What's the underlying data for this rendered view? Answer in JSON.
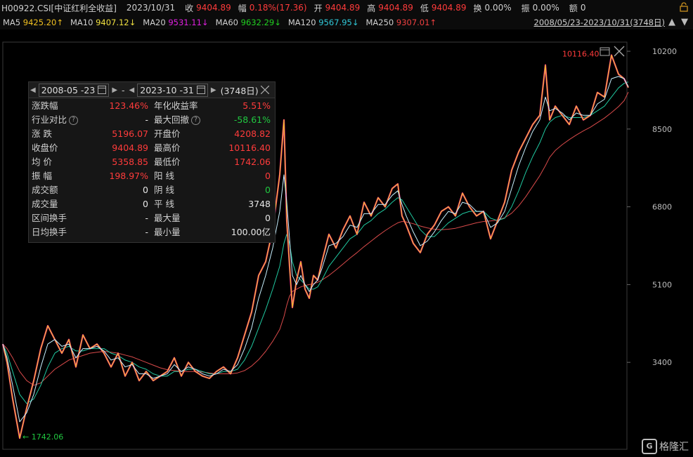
{
  "header": {
    "code": "H00922.CSI[中证红利全收益]",
    "date": "2023/10/31",
    "close_label": "收",
    "close": "9404.89",
    "change_label": "幅",
    "change": "0.18%(17.36)",
    "open_label": "开",
    "open": "9404.89",
    "high_label": "高",
    "high": "9404.89",
    "low_label": "低",
    "low": "9404.89",
    "turnover_label": "换",
    "turnover": "0.00%",
    "amplitude_label": "振",
    "amplitude": "0.00%",
    "amount_label": "额",
    "amount": "0"
  },
  "ma_bar": [
    {
      "label": "MA5",
      "value": "9425.20↑",
      "color": "#f0c020"
    },
    {
      "label": "MA10",
      "value": "9407.12↓",
      "color": "#f0e040"
    },
    {
      "label": "MA20",
      "value": "9531.11↓",
      "color": "#e020e0"
    },
    {
      "label": "MA60",
      "value": "9632.29↓",
      "color": "#20d020"
    },
    {
      "label": "MA120",
      "value": "9567.95↓",
      "color": "#30c8d8"
    },
    {
      "label": "MA250",
      "value": "9307.01↑",
      "color": "#f04040"
    }
  ],
  "range_text": "2008/05/23-2023/10/31(3748日)",
  "panel": {
    "start_date": "2008-05 -23",
    "dash": "-",
    "end_date": "2023-10 -31",
    "days": "(3748日)",
    "rows": [
      {
        "l1": "涨跌幅",
        "v1": "123.46%",
        "c1": "red",
        "l2": "年化收益率",
        "v2": "5.51%",
        "c2": "red"
      },
      {
        "l1": "行业对比",
        "q1": "?",
        "v1": "-",
        "c1": "white",
        "l2": "最大回撤",
        "q2": "?",
        "v2": "-58.61%",
        "c2": "green"
      },
      {
        "l1": "涨    跌",
        "v1": "5196.07",
        "c1": "red",
        "l2": "开盘价",
        "v2": "4208.82",
        "c2": "red"
      },
      {
        "l1": "收盘价",
        "v1": "9404.89",
        "c1": "red",
        "l2": "最高价",
        "v2": "10116.40",
        "c2": "red"
      },
      {
        "l1": "均    价",
        "v1": "5358.85",
        "c1": "red",
        "l2": "最低价",
        "v2": "1742.06",
        "c2": "red"
      },
      {
        "l1": "振    幅",
        "v1": "198.97%",
        "c1": "red",
        "l2": "阳    线",
        "v2": "0",
        "c2": "red"
      },
      {
        "l1": "成交额",
        "v1": "0",
        "c1": "white",
        "l2": "阴    线",
        "v2": "0",
        "c2": "green"
      },
      {
        "l1": "成交量",
        "v1": "0",
        "c1": "white",
        "l2": "平    线",
        "v2": "3748",
        "c2": "white"
      },
      {
        "l1": "区间换手",
        "v1": "-",
        "c1": "white",
        "l2": "最大量",
        "v2": "0",
        "c2": "white"
      },
      {
        "l1": "日均换手",
        "v1": "-",
        "c1": "white",
        "l2": "最小量",
        "v2": "100.00亿",
        "c2": "white"
      }
    ]
  },
  "watermark": "格隆汇",
  "colors": {
    "up": "#ff3b3b",
    "down": "#20c840",
    "price": "#e8d020"
  },
  "chart_data": {
    "type": "line",
    "y_ticks": [
      "10200",
      "8500",
      "6800",
      "5100",
      "3400"
    ],
    "ylim": [
      1500,
      10400
    ],
    "max_label": "10116.40",
    "min_label": "1742.06",
    "x": [
      0,
      6,
      14,
      24,
      34,
      44,
      54,
      64,
      74,
      84,
      94,
      104,
      114,
      124,
      134,
      144,
      154,
      164,
      174,
      184,
      194,
      204,
      214,
      224,
      234,
      244,
      254,
      264,
      274,
      284,
      294,
      304,
      314,
      324,
      334,
      344,
      354,
      364,
      374,
      384,
      394,
      400,
      404,
      408,
      412,
      418,
      424,
      430,
      436,
      442,
      448,
      454,
      464,
      474,
      484,
      494,
      504,
      514,
      524,
      534,
      544,
      554,
      562,
      568,
      574,
      584,
      594,
      604,
      614,
      624,
      634,
      644,
      654,
      664,
      674,
      684,
      694,
      704,
      714,
      724,
      734,
      744,
      754,
      764,
      772,
      778,
      786,
      796,
      806,
      816,
      826,
      836,
      846,
      856,
      866,
      876,
      884,
      890
    ],
    "close": [
      3800,
      3400,
      2600,
      1742,
      2400,
      3000,
      3700,
      4200,
      3900,
      3600,
      3900,
      3300,
      4000,
      3700,
      3800,
      3600,
      3300,
      3600,
      3100,
      3400,
      3000,
      3200,
      3000,
      3100,
      3200,
      3500,
      3100,
      3400,
      3200,
      3100,
      3050,
      3200,
      3300,
      3150,
      3500,
      4000,
      4500,
      5300,
      5600,
      6300,
      7500,
      8700,
      6500,
      5500,
      4600,
      5200,
      5600,
      5000,
      4800,
      5300,
      5200,
      5600,
      6200,
      5900,
      6300,
      6600,
      6200,
      6900,
      6600,
      7000,
      6800,
      7200,
      7300,
      6600,
      6400,
      6000,
      5800,
      6200,
      6400,
      6700,
      6800,
      6600,
      7100,
      6800,
      6600,
      6700,
      6100,
      6500,
      6900,
      7600,
      8000,
      8300,
      8600,
      8800,
      9900,
      8700,
      9000,
      8800,
      8600,
      9000,
      8700,
      8800,
      9300,
      9200,
      10116,
      9700,
      9600,
      9405
    ],
    "ma_short": [
      3800,
      3500,
      2900,
      2100,
      2300,
      2700,
      3300,
      3800,
      3900,
      3750,
      3800,
      3500,
      3700,
      3700,
      3750,
      3650,
      3450,
      3500,
      3300,
      3350,
      3150,
      3150,
      3050,
      3100,
      3150,
      3350,
      3200,
      3300,
      3250,
      3150,
      3100,
      3150,
      3250,
      3200,
      3350,
      3700,
      4150,
      4800,
      5300,
      5900,
      6700,
      7500,
      6900,
      6100,
      5300,
      5100,
      5300,
      5100,
      4950,
      5100,
      5200,
      5450,
      5950,
      6000,
      6150,
      6400,
      6350,
      6650,
      6650,
      6850,
      6850,
      7050,
      7150,
      6850,
      6600,
      6250,
      5950,
      6050,
      6250,
      6500,
      6700,
      6650,
      6900,
      6850,
      6700,
      6700,
      6350,
      6450,
      6700,
      7200,
      7700,
      8100,
      8450,
      8700,
      9200,
      8900,
      8950,
      8850,
      8700,
      8850,
      8800,
      8800,
      9050,
      9150,
      9600,
      9650,
      9600,
      9425
    ],
    "ma_mid": [
      3800,
      3600,
      3200,
      2700,
      2500,
      2600,
      2900,
      3300,
      3600,
      3700,
      3750,
      3650,
      3650,
      3700,
      3700,
      3700,
      3600,
      3550,
      3450,
      3400,
      3300,
      3250,
      3150,
      3100,
      3100,
      3200,
      3200,
      3250,
      3250,
      3200,
      3150,
      3150,
      3200,
      3200,
      3250,
      3450,
      3750,
      4150,
      4550,
      5000,
      5500,
      6000,
      6200,
      6000,
      5600,
      5300,
      5200,
      5100,
      5000,
      5000,
      5050,
      5200,
      5500,
      5700,
      5900,
      6100,
      6200,
      6400,
      6500,
      6650,
      6750,
      6900,
      7000,
      6950,
      6800,
      6550,
      6300,
      6150,
      6150,
      6300,
      6450,
      6550,
      6650,
      6700,
      6700,
      6700,
      6550,
      6500,
      6550,
      6800,
      7150,
      7550,
      7900,
      8200,
      8500,
      8650,
      8750,
      8800,
      8750,
      8750,
      8750,
      8800,
      8900,
      9000,
      9200,
      9400,
      9500,
      9530
    ],
    "ma_long": [
      3800,
      3700,
      3500,
      3200,
      3000,
      2900,
      2950,
      3100,
      3250,
      3350,
      3450,
      3500,
      3550,
      3600,
      3620,
      3640,
      3620,
      3600,
      3560,
      3520,
      3460,
      3400,
      3340,
      3280,
      3240,
      3220,
      3200,
      3200,
      3200,
      3190,
      3170,
      3150,
      3150,
      3150,
      3170,
      3220,
      3320,
      3460,
      3640,
      3860,
      4120,
      4400,
      4650,
      4850,
      4950,
      5000,
      5050,
      5080,
      5100,
      5120,
      5150,
      5200,
      5300,
      5420,
      5550,
      5680,
      5800,
      5930,
      6050,
      6170,
      6280,
      6380,
      6450,
      6480,
      6470,
      6430,
      6380,
      6340,
      6310,
      6300,
      6310,
      6330,
      6370,
      6410,
      6450,
      6480,
      6490,
      6510,
      6560,
      6660,
      6820,
      7020,
      7250,
      7480,
      7700,
      7880,
      8030,
      8160,
      8270,
      8370,
      8460,
      8540,
      8640,
      8740,
      8860,
      8990,
      9120,
      9307
    ]
  }
}
